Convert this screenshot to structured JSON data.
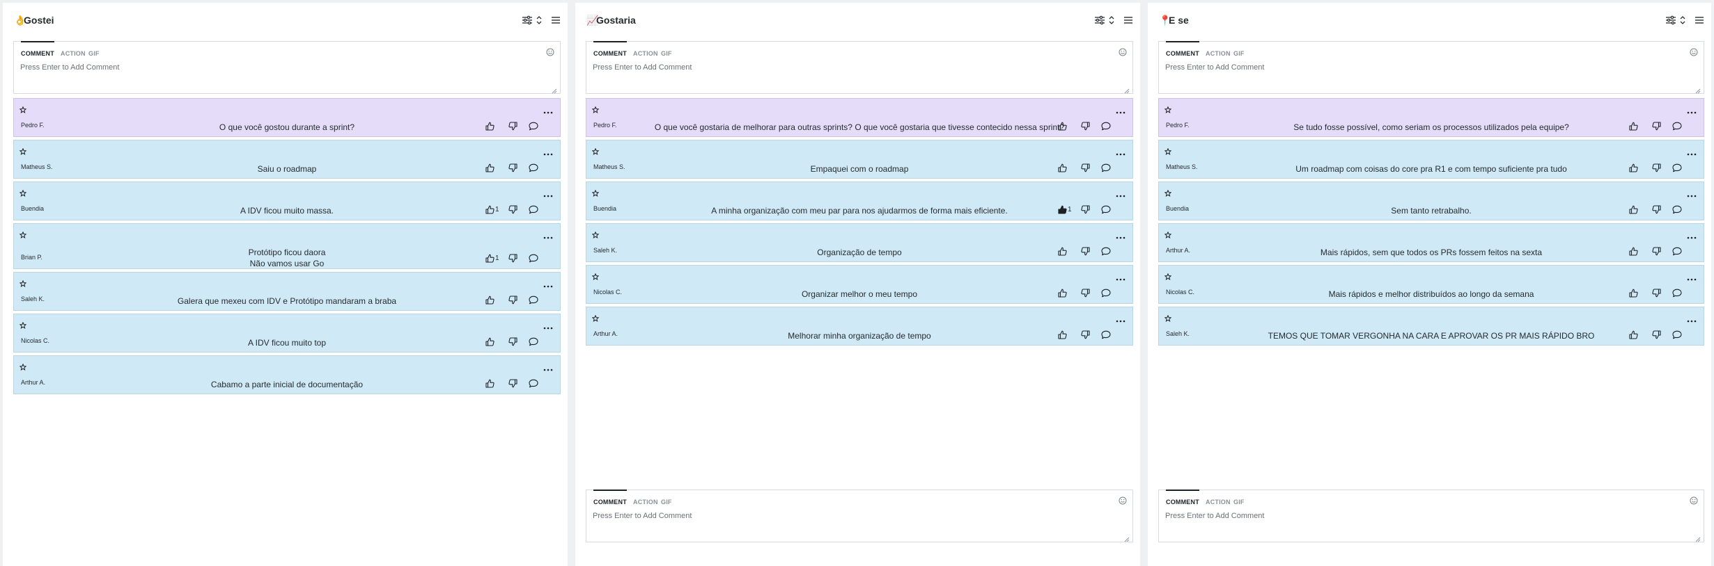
{
  "composer": {
    "tabs": [
      "COMMENT",
      "ACTION",
      "GIF"
    ],
    "placeholder": "Press Enter to Add Comment"
  },
  "columns": [
    {
      "emoji": "👌",
      "title": "Gostei",
      "cards": [
        {
          "text": "O que você gostou durante a sprint?",
          "author": "Pedro F.",
          "lead": true,
          "votes": ""
        },
        {
          "text": "Saiu o roadmap",
          "author": "Matheus S.",
          "votes": ""
        },
        {
          "text": "A IDV ficou muito massa.",
          "author": "Buendia",
          "votes": "1"
        },
        {
          "text": "Protótipo ficou daora\nNão vamos usar Go",
          "author": "Brian P.",
          "votes": "1"
        },
        {
          "text": "Galera que mexeu com IDV e Protótipo mandaram a braba",
          "author": "Saleh K.",
          "votes": ""
        },
        {
          "text": "A IDV ficou muito top",
          "author": "Nicolas C.",
          "votes": ""
        },
        {
          "text": "Cabamo a parte inicial de documentação",
          "author": "Arthur A.",
          "votes": ""
        }
      ]
    },
    {
      "emoji": "📈",
      "title": "Gostaria",
      "cards": [
        {
          "text": "O que você gostaria de melhorar para outras sprints? O que você gostaria que tivesse contecido nessa sprint?",
          "author": "Pedro F.",
          "lead": true,
          "votes": ""
        },
        {
          "text": "Empaquei com o roadmap",
          "author": "Matheus S.",
          "votes": ""
        },
        {
          "text": "A minha organização com meu par para nos ajudarmos de forma mais eficiente.",
          "author": "Buendia",
          "votes": "1",
          "upvoted": true
        },
        {
          "text": "Organização de tempo",
          "author": "Saleh K.",
          "votes": ""
        },
        {
          "text": "Organizar melhor o meu tempo",
          "author": "Nicolas C.",
          "votes": ""
        },
        {
          "text": "Melhorar minha organização de tempo",
          "author": "Arthur A.",
          "votes": ""
        }
      ]
    },
    {
      "emoji": "📍",
      "title": "E se",
      "cards": [
        {
          "text": "Se tudo fosse possível, como seriam os processos utilizados pela equipe?",
          "author": "Pedro F.",
          "lead": true,
          "votes": ""
        },
        {
          "text": "Um roadmap com coisas do core pra R1 e com tempo suficiente pra tudo",
          "author": "Matheus S.",
          "votes": ""
        },
        {
          "text": "Sem tanto retrabalho.",
          "author": "Buendia",
          "votes": ""
        },
        {
          "text": "Mais rápidos, sem que todos os PRs fossem feitos na sexta",
          "author": "Arthur A.",
          "votes": ""
        },
        {
          "text": "Mais rápidos e melhor distribuídos ao longo da semana",
          "author": "Nicolas C.",
          "votes": ""
        },
        {
          "text": "TEMOS QUE TOMAR VERGONHA NA CARA E APROVAR OS PR MAIS RÁPIDO BRO",
          "author": "Saleh K.",
          "votes": ""
        }
      ]
    }
  ],
  "icons": {
    "star": "star-outline-icon",
    "more": "more-horizontal-icon",
    "upvote": "thumbs-up-icon",
    "downvote": "thumbs-down-icon",
    "reply": "comment-bubble-icon",
    "filter": "sliders-icon",
    "sort": "sort-arrows-icon",
    "menu": "hamburger-menu-icon",
    "emoji": "smiley-icon"
  },
  "colors": {
    "lead_card": "#e4dcf9",
    "card": "#cfeaf6"
  }
}
